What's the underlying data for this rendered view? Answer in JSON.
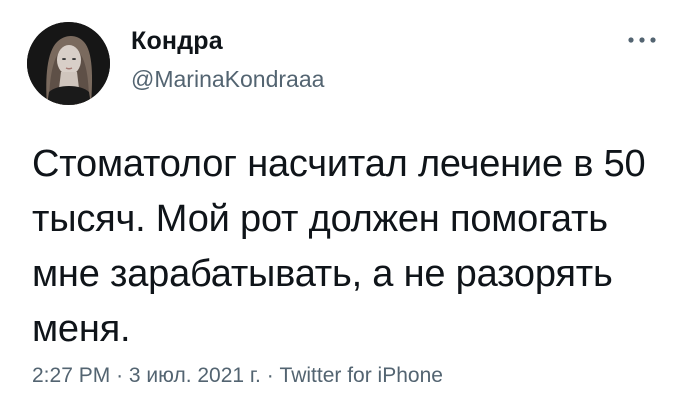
{
  "user": {
    "display_name": "Кондра",
    "handle": "@MarinaKondraaa",
    "avatar_icon": "user-avatar-photo"
  },
  "menu": {
    "icon": "more-options-icon"
  },
  "tweet": {
    "text": "Стоматолог насчитал лечение в 50 тысяч. Мой рот должен помогать мне зарабатывать, а не разорять меня."
  },
  "meta": {
    "time": "2:27 PM",
    "separator": "·",
    "date": "3 июл. 2021 г.",
    "source": "Twitter for iPhone"
  },
  "colors": {
    "text": "#0f1419",
    "secondary": "#536471",
    "background": "#ffffff"
  }
}
